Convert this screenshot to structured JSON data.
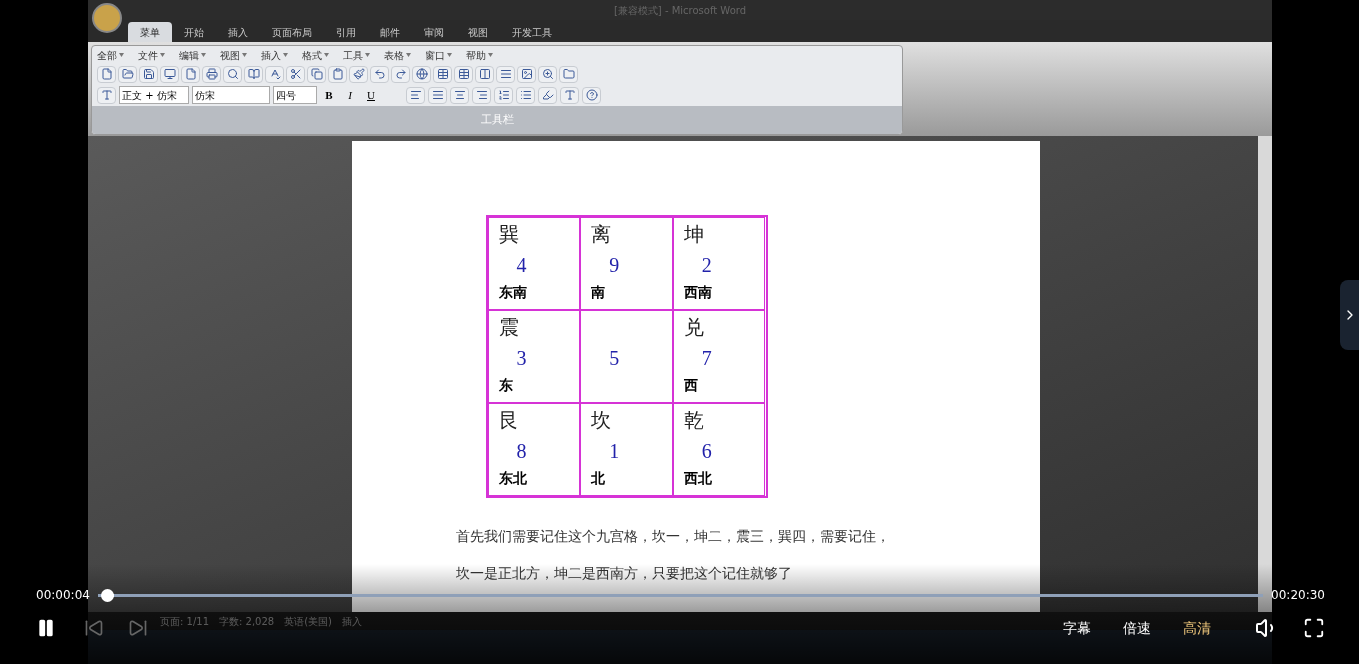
{
  "window": {
    "title": "[兼容模式] - Microsoft Word"
  },
  "ribbon_tabs": [
    {
      "label": "菜单",
      "selected": true
    },
    {
      "label": "开始",
      "selected": false
    },
    {
      "label": "插入",
      "selected": false
    },
    {
      "label": "页面布局",
      "selected": false
    },
    {
      "label": "引用",
      "selected": false
    },
    {
      "label": "邮件",
      "selected": false
    },
    {
      "label": "审阅",
      "selected": false
    },
    {
      "label": "视图",
      "selected": false
    },
    {
      "label": "开发工具",
      "selected": false
    }
  ],
  "menu": [
    "全部",
    "文件",
    "编辑",
    "视图",
    "插入",
    "格式",
    "工具",
    "表格",
    "窗口",
    "帮助"
  ],
  "format_bar": {
    "style": "正文 + 仿宋",
    "font": "仿宋",
    "size": "四号",
    "bold": "B",
    "italic": "I",
    "underline": "U"
  },
  "toolbar_group_label": "工具栏",
  "grid_rows": [
    [
      {
        "name": "巽",
        "number": "4",
        "direction": "东南"
      },
      {
        "name": "离",
        "number": "9",
        "direction": "南"
      },
      {
        "name": "坤",
        "number": "2",
        "direction": "西南"
      }
    ],
    [
      {
        "name": "震",
        "number": "3",
        "direction": "东"
      },
      {
        "number": "5"
      },
      {
        "name": "兑",
        "number": "7",
        "direction": "西"
      }
    ],
    [
      {
        "name": "艮",
        "number": "8",
        "direction": "东北"
      },
      {
        "name": "坎",
        "number": "1",
        "direction": "北"
      },
      {
        "name": "乾",
        "number": "6",
        "direction": "西北"
      }
    ]
  ],
  "paragraphs": [
    "首先我们需要记住这个九宫格，坎一，坤二，震三，巽四，需要记住，",
    "坎一是正北方，坤二是西南方，只要把这个记住就够了"
  ],
  "status_bar": [
    "页面: 1/11",
    "字数: 2,028",
    "英语(美国)",
    "插入"
  ],
  "player": {
    "current_time": "00:00:04",
    "total_time": "00:20:30",
    "level": 0.003,
    "playing": true,
    "options": [
      {
        "label": "字幕",
        "selected": false
      },
      {
        "label": "倍速",
        "selected": false
      },
      {
        "label": "高清",
        "selected": true
      }
    ]
  }
}
